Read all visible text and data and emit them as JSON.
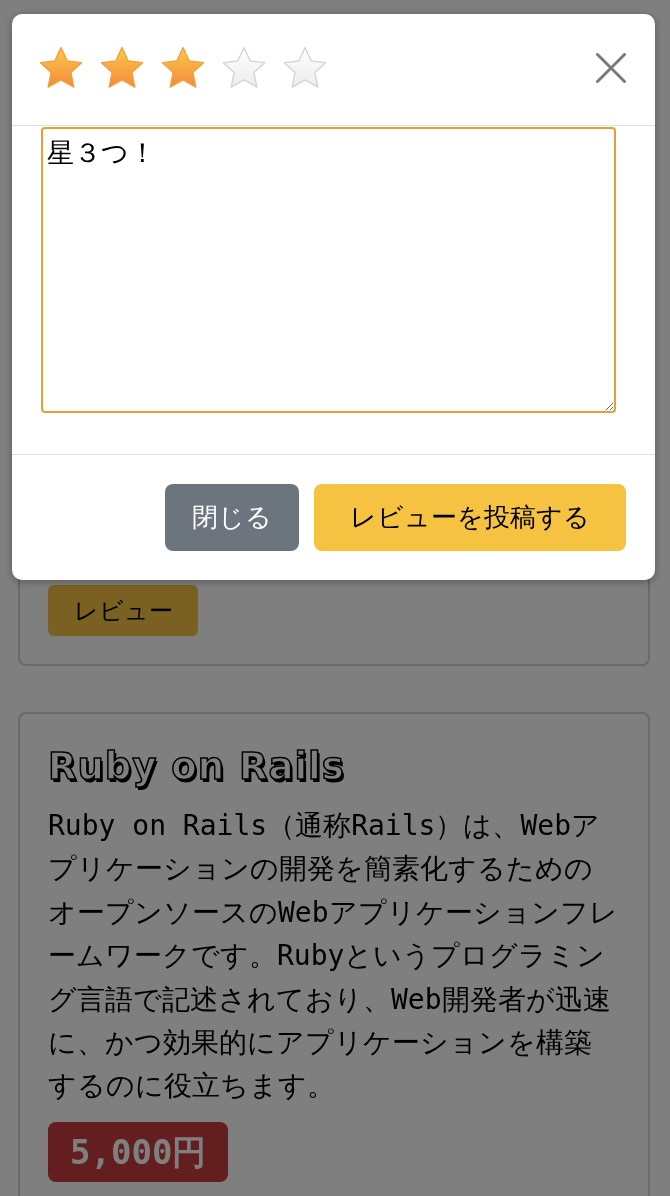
{
  "dialog": {
    "rating": {
      "stars": 3
    },
    "review": {
      "value": "星３つ！"
    },
    "buttons": [
      {
        "label": "閉じる",
        "kind": "secondary"
      },
      {
        "label": "レビューを投稿する",
        "kind": "primary"
      }
    ]
  },
  "cards": [
    {
      "buttons": [
        {
          "label": "レビュー"
        }
      ]
    },
    {
      "title": "Ruby on Rails",
      "description": "Ruby on Rails（通称Rails）は、Webアプリケーションの開発を簡素化するためのオープンソースのWebアプリケーションフレームワークです。Rubyというプログラミング言語で記述されており、Web開発者が迅速に、かつ効果的にアプリケーションを構築するのに役立ちます。",
      "price": "5,000円"
    }
  ]
}
